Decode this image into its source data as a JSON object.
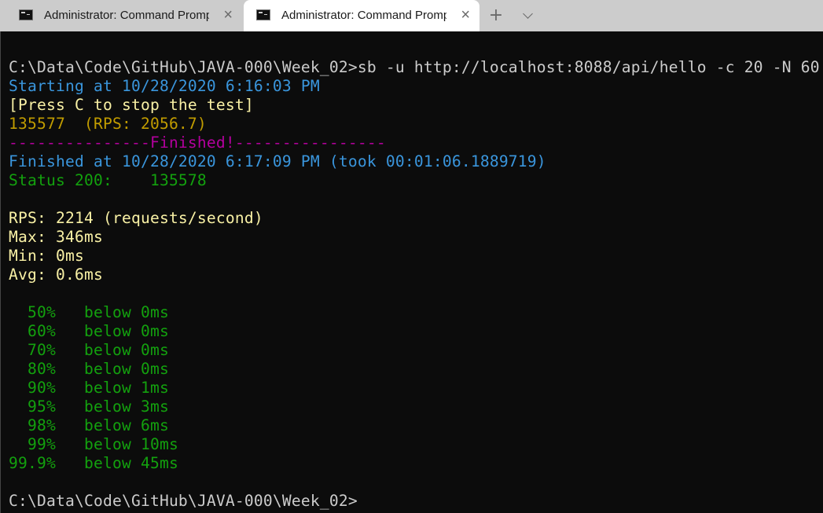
{
  "tabs": [
    {
      "title": "Administrator: Command Prompt",
      "icon": "cmd-icon",
      "active": false
    },
    {
      "title": "Administrator: Command Prompt",
      "icon": "cmd-icon",
      "active": true
    }
  ],
  "tabbar": {
    "new_tab": "+",
    "dropdown": "chevron-down-icon",
    "close": "×"
  },
  "colors": {
    "terminal_bg": "#0c0c0c",
    "default": "#cccccc",
    "blue": "#3a96dd",
    "light_yellow": "#f9f1a5",
    "dark_yellow": "#c19c00",
    "magenta": "#b4009e",
    "green": "#13a10e"
  },
  "terminal": {
    "command_line": "C:\\Data\\Code\\GitHub\\JAVA-000\\Week_02>sb -u http://localhost:8088/api/hello -c 20 -N 60",
    "starting": "Starting at 10/28/2020 6:16:03 PM",
    "press_c": "[Press C to stop the test]",
    "progress": "135577  (RPS: 2056.7)",
    "finished_banner": "---------------Finished!----------------",
    "finished_at": "Finished at 10/28/2020 6:17:09 PM (took 00:01:06.1889719)",
    "status_200": "Status 200:    135578",
    "rps": "RPS: 2214 (requests/second)",
    "max": "Max: 346ms",
    "min": "Min: 0ms",
    "avg": "Avg: 0.6ms",
    "percentiles": [
      "  50%   below 0ms",
      "  60%   below 0ms",
      "  70%   below 0ms",
      "  80%   below 0ms",
      "  90%   below 1ms",
      "  95%   below 3ms",
      "  98%   below 6ms",
      "  99%   below 10ms",
      "99.9%   below 45ms"
    ],
    "prompt": "C:\\Data\\Code\\GitHub\\JAVA-000\\Week_02>"
  }
}
